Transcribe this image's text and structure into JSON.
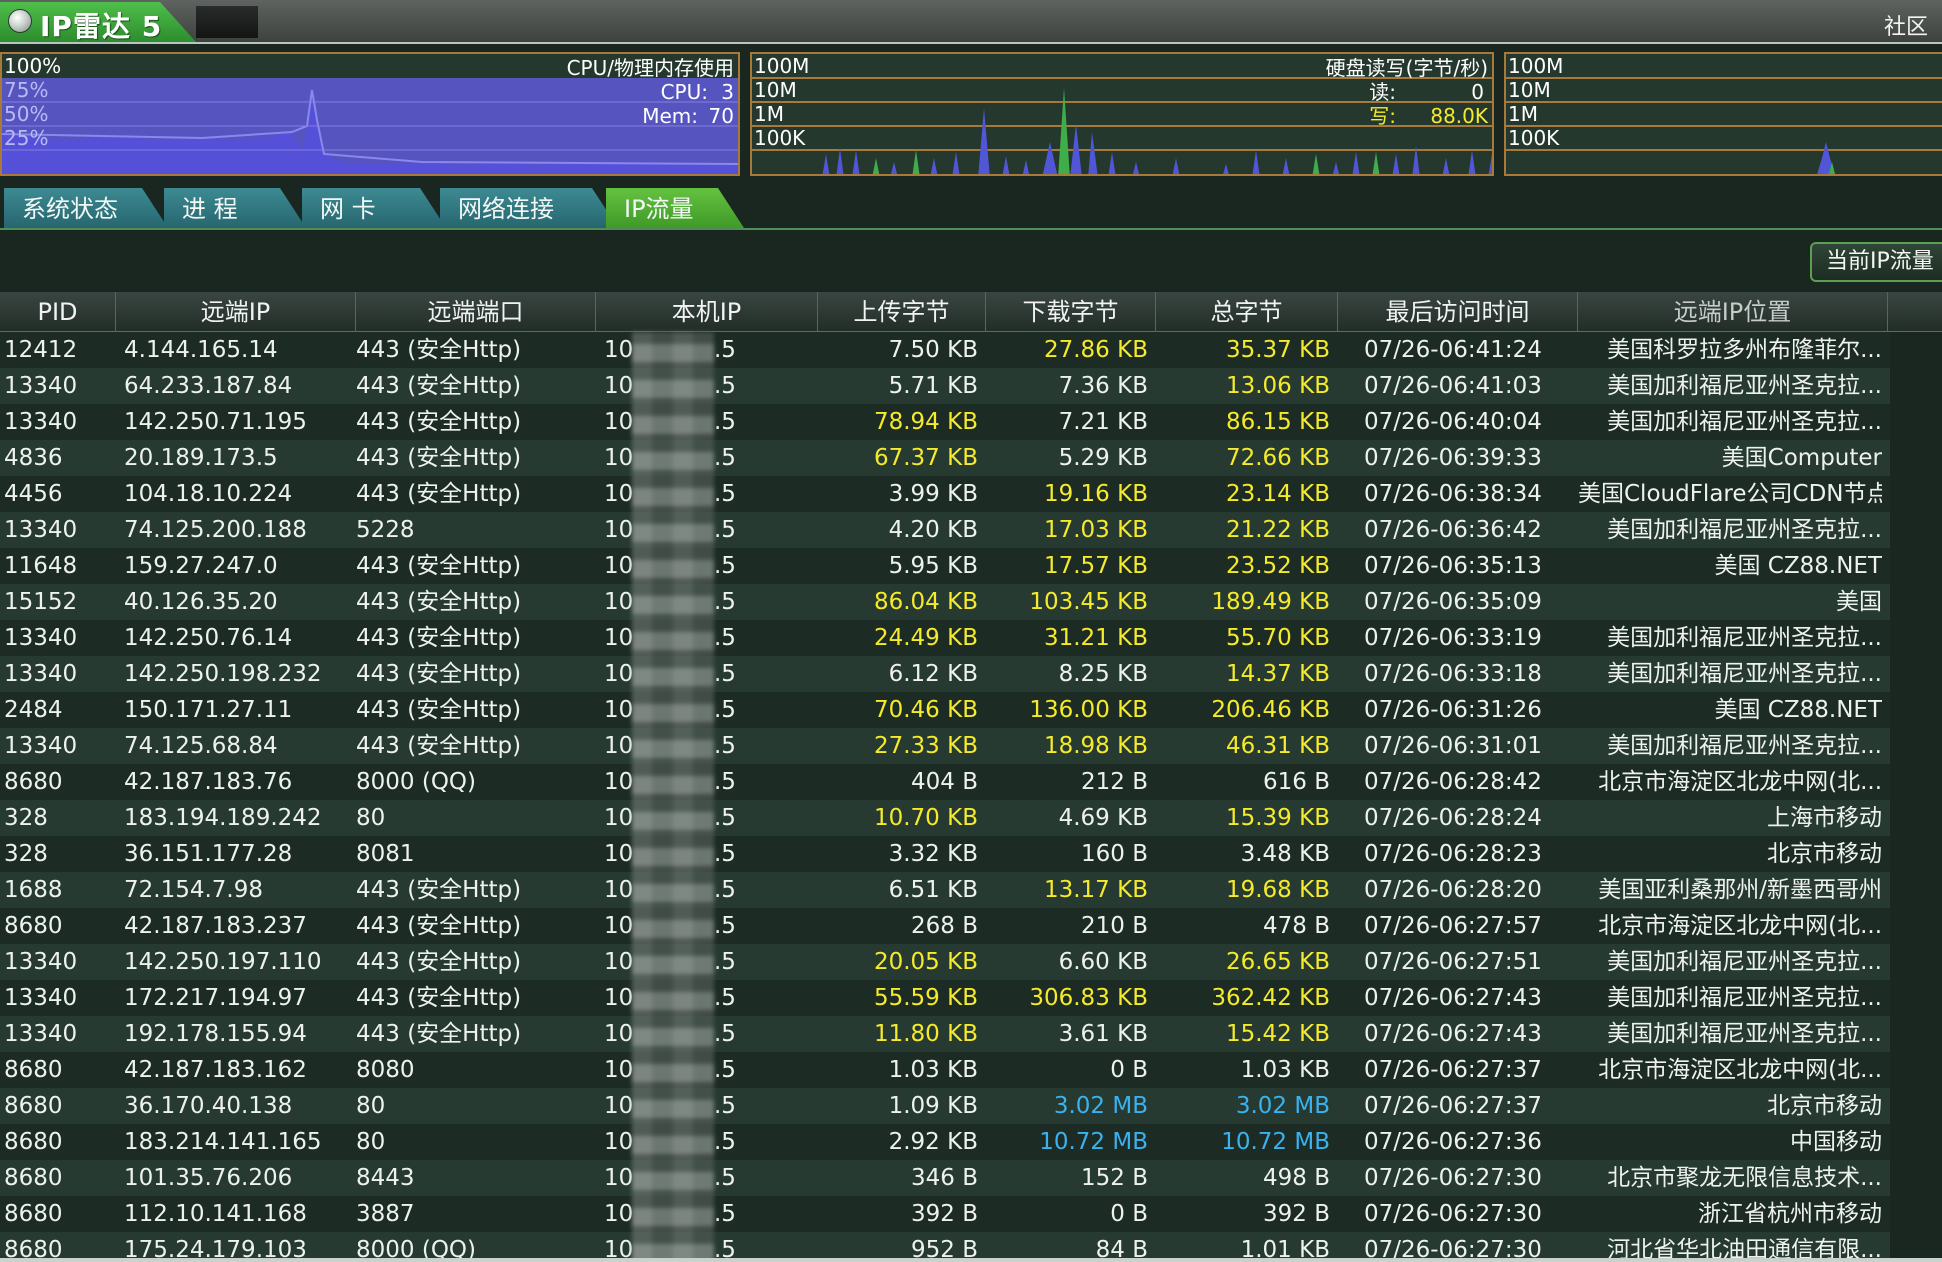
{
  "app": {
    "title": "IP雷达 5",
    "community_link": "社区"
  },
  "cpu_panel": {
    "title": "CPU/物理内存使用",
    "scale_labels": [
      "100%",
      "75%",
      "50%",
      "25%"
    ],
    "cpu_label": "CPU:",
    "cpu_value": "3",
    "mem_label": "Mem:",
    "mem_value": "70"
  },
  "disk_panel": {
    "title": "硬盘读写(字节/秒)",
    "scale_labels": [
      "100M",
      "10M",
      "1M",
      "100K"
    ],
    "read_label": "读:",
    "read_value": "0",
    "write_label": "写:",
    "write_value": "88.0K"
  },
  "net_panel": {
    "scale_labels": [
      "100M",
      "10M",
      "1M",
      "100K"
    ]
  },
  "tabs": [
    {
      "label": "系统状态"
    },
    {
      "label": "进 程"
    },
    {
      "label": "网 卡"
    },
    {
      "label": "网络连接"
    },
    {
      "label": "IP流量"
    }
  ],
  "active_tab": "IP流量",
  "toolbar": {
    "current_ip_button": "当前IP流量"
  },
  "colors": {
    "highlight_yellow": "#f5ea2c",
    "highlight_blue": "#3ab2ef",
    "active_tab": "#4fae32"
  },
  "table": {
    "columns": [
      "PID",
      "远端IP",
      "远端端口",
      "本机IP",
      "上传字节",
      "下载字节",
      "总字节",
      "最后访问时间",
      "远端IP位置"
    ],
    "rows": [
      {
        "pid": "12412",
        "remote_ip": "4.144.165.14",
        "port": "443 (安全Http)",
        "local_ip_start": "10",
        "local_ip_end": ".5",
        "upload": "7.50 KB",
        "download": "27.86 KB",
        "total": "35.37 KB",
        "time": "07/26-06:41:24",
        "location": "美国科罗拉多州布隆菲尔...",
        "hl_upload": "",
        "hl_download": "yellow",
        "hl_total": "yellow"
      },
      {
        "pid": "13340",
        "remote_ip": "64.233.187.84",
        "port": "443 (安全Http)",
        "local_ip_start": "10",
        "local_ip_end": ".5",
        "upload": "5.71 KB",
        "download": "7.36 KB",
        "total": "13.06 KB",
        "time": "07/26-06:41:03",
        "location": "美国加利福尼亚州圣克拉...",
        "hl_upload": "",
        "hl_download": "",
        "hl_total": "yellow"
      },
      {
        "pid": "13340",
        "remote_ip": "142.250.71.195",
        "port": "443 (安全Http)",
        "local_ip_start": "10",
        "local_ip_end": ".5",
        "upload": "78.94 KB",
        "download": "7.21 KB",
        "total": "86.15 KB",
        "time": "07/26-06:40:04",
        "location": "美国加利福尼亚州圣克拉...",
        "hl_upload": "yellow",
        "hl_download": "",
        "hl_total": "yellow"
      },
      {
        "pid": "4836",
        "remote_ip": "20.189.173.5",
        "port": "443 (安全Http)",
        "local_ip_start": "10",
        "local_ip_end": ".5",
        "upload": "67.37 KB",
        "download": "5.29 KB",
        "total": "72.66 KB",
        "time": "07/26-06:39:33",
        "location": "美国Computer",
        "hl_upload": "yellow",
        "hl_download": "",
        "hl_total": "yellow"
      },
      {
        "pid": "4456",
        "remote_ip": "104.18.10.224",
        "port": "443 (安全Http)",
        "local_ip_start": "10",
        "local_ip_end": ".5",
        "upload": "3.99 KB",
        "download": "19.16 KB",
        "total": "23.14 KB",
        "time": "07/26-06:38:34",
        "location": "美国CloudFlare公司CDN节点",
        "hl_upload": "",
        "hl_download": "yellow",
        "hl_total": "yellow"
      },
      {
        "pid": "13340",
        "remote_ip": "74.125.200.188",
        "port": "5228",
        "local_ip_start": "10",
        "local_ip_end": ".5",
        "upload": "4.20 KB",
        "download": "17.03 KB",
        "total": "21.22 KB",
        "time": "07/26-06:36:42",
        "location": "美国加利福尼亚州圣克拉...",
        "hl_upload": "",
        "hl_download": "yellow",
        "hl_total": "yellow"
      },
      {
        "pid": "11648",
        "remote_ip": "159.27.247.0",
        "port": "443 (安全Http)",
        "local_ip_start": "10",
        "local_ip_end": ".5",
        "upload": "5.95 KB",
        "download": "17.57 KB",
        "total": "23.52 KB",
        "time": "07/26-06:35:13",
        "location": "美国 CZ88.NET",
        "hl_upload": "",
        "hl_download": "yellow",
        "hl_total": "yellow"
      },
      {
        "pid": "15152",
        "remote_ip": "40.126.35.20",
        "port": "443 (安全Http)",
        "local_ip_start": "10",
        "local_ip_end": ".5",
        "upload": "86.04 KB",
        "download": "103.45 KB",
        "total": "189.49 KB",
        "time": "07/26-06:35:09",
        "location": "美国",
        "hl_upload": "yellow",
        "hl_download": "yellow",
        "hl_total": "yellow"
      },
      {
        "pid": "13340",
        "remote_ip": "142.250.76.14",
        "port": "443 (安全Http)",
        "local_ip_start": "10",
        "local_ip_end": ".5",
        "upload": "24.49 KB",
        "download": "31.21 KB",
        "total": "55.70 KB",
        "time": "07/26-06:33:19",
        "location": "美国加利福尼亚州圣克拉...",
        "hl_upload": "yellow",
        "hl_download": "yellow",
        "hl_total": "yellow"
      },
      {
        "pid": "13340",
        "remote_ip": "142.250.198.232",
        "port": "443 (安全Http)",
        "local_ip_start": "10",
        "local_ip_end": ".5",
        "upload": "6.12 KB",
        "download": "8.25 KB",
        "total": "14.37 KB",
        "time": "07/26-06:33:18",
        "location": "美国加利福尼亚州圣克拉...",
        "hl_upload": "",
        "hl_download": "",
        "hl_total": "yellow"
      },
      {
        "pid": "2484",
        "remote_ip": "150.171.27.11",
        "port": "443 (安全Http)",
        "local_ip_start": "10",
        "local_ip_end": ".5",
        "upload": "70.46 KB",
        "download": "136.00 KB",
        "total": "206.46 KB",
        "time": "07/26-06:31:26",
        "location": "美国 CZ88.NET",
        "hl_upload": "yellow",
        "hl_download": "yellow",
        "hl_total": "yellow"
      },
      {
        "pid": "13340",
        "remote_ip": "74.125.68.84",
        "port": "443 (安全Http)",
        "local_ip_start": "10",
        "local_ip_end": ".5",
        "upload": "27.33 KB",
        "download": "18.98 KB",
        "total": "46.31 KB",
        "time": "07/26-06:31:01",
        "location": "美国加利福尼亚州圣克拉...",
        "hl_upload": "yellow",
        "hl_download": "yellow",
        "hl_total": "yellow"
      },
      {
        "pid": "8680",
        "remote_ip": "42.187.183.76",
        "port": "8000 (QQ)",
        "local_ip_start": "10",
        "local_ip_end": ".5",
        "upload": "404 B",
        "download": "212 B",
        "total": "616 B",
        "time": "07/26-06:28:42",
        "location": "北京市海淀区北龙中网(北...",
        "hl_upload": "",
        "hl_download": "",
        "hl_total": ""
      },
      {
        "pid": "328",
        "remote_ip": "183.194.189.242",
        "port": "80",
        "local_ip_start": "10",
        "local_ip_end": ".5",
        "upload": "10.70 KB",
        "download": "4.69 KB",
        "total": "15.39 KB",
        "time": "07/26-06:28:24",
        "location": "上海市移动",
        "hl_upload": "yellow",
        "hl_download": "",
        "hl_total": "yellow"
      },
      {
        "pid": "328",
        "remote_ip": "36.151.177.28",
        "port": "8081",
        "local_ip_start": "10",
        "local_ip_end": ".5",
        "upload": "3.32 KB",
        "download": "160 B",
        "total": "3.48 KB",
        "time": "07/26-06:28:23",
        "location": "北京市移动",
        "hl_upload": "",
        "hl_download": "",
        "hl_total": ""
      },
      {
        "pid": "1688",
        "remote_ip": "72.154.7.98",
        "port": "443 (安全Http)",
        "local_ip_start": "10",
        "local_ip_end": ".5",
        "upload": "6.51 KB",
        "download": "13.17 KB",
        "total": "19.68 KB",
        "time": "07/26-06:28:20",
        "location": "美国亚利桑那州/新墨西哥州",
        "hl_upload": "",
        "hl_download": "yellow",
        "hl_total": "yellow"
      },
      {
        "pid": "8680",
        "remote_ip": "42.187.183.237",
        "port": "443 (安全Http)",
        "local_ip_start": "10",
        "local_ip_end": ".5",
        "upload": "268 B",
        "download": "210 B",
        "total": "478 B",
        "time": "07/26-06:27:57",
        "location": "北京市海淀区北龙中网(北...",
        "hl_upload": "",
        "hl_download": "",
        "hl_total": ""
      },
      {
        "pid": "13340",
        "remote_ip": "142.250.197.110",
        "port": "443 (安全Http)",
        "local_ip_start": "10",
        "local_ip_end": ".5",
        "upload": "20.05 KB",
        "download": "6.60 KB",
        "total": "26.65 KB",
        "time": "07/26-06:27:51",
        "location": "美国加利福尼亚州圣克拉...",
        "hl_upload": "yellow",
        "hl_download": "",
        "hl_total": "yellow"
      },
      {
        "pid": "13340",
        "remote_ip": "172.217.194.97",
        "port": "443 (安全Http)",
        "local_ip_start": "10",
        "local_ip_end": ".5",
        "upload": "55.59 KB",
        "download": "306.83 KB",
        "total": "362.42 KB",
        "time": "07/26-06:27:43",
        "location": "美国加利福尼亚州圣克拉...",
        "hl_upload": "yellow",
        "hl_download": "yellow",
        "hl_total": "yellow"
      },
      {
        "pid": "13340",
        "remote_ip": "192.178.155.94",
        "port": "443 (安全Http)",
        "local_ip_start": "10",
        "local_ip_end": ".5",
        "upload": "11.80 KB",
        "download": "3.61 KB",
        "total": "15.42 KB",
        "time": "07/26-06:27:43",
        "location": "美国加利福尼亚州圣克拉...",
        "hl_upload": "yellow",
        "hl_download": "",
        "hl_total": "yellow"
      },
      {
        "pid": "8680",
        "remote_ip": "42.187.183.162",
        "port": "8080",
        "local_ip_start": "10",
        "local_ip_end": ".5",
        "upload": "1.03 KB",
        "download": "0 B",
        "total": "1.03 KB",
        "time": "07/26-06:27:37",
        "location": "北京市海淀区北龙中网(北...",
        "hl_upload": "",
        "hl_download": "",
        "hl_total": ""
      },
      {
        "pid": "8680",
        "remote_ip": "36.170.40.138",
        "port": "80",
        "local_ip_start": "10",
        "local_ip_end": ".5",
        "upload": "1.09 KB",
        "download": "3.02 MB",
        "total": "3.02 MB",
        "time": "07/26-06:27:37",
        "location": "北京市移动",
        "hl_upload": "",
        "hl_download": "blue",
        "hl_total": "blue"
      },
      {
        "pid": "8680",
        "remote_ip": "183.214.141.165",
        "port": "80",
        "local_ip_start": "10",
        "local_ip_end": ".5",
        "upload": "2.92 KB",
        "download": "10.72 MB",
        "total": "10.72 MB",
        "time": "07/26-06:27:36",
        "location": "中国移动",
        "hl_upload": "",
        "hl_download": "blue",
        "hl_total": "blue"
      },
      {
        "pid": "8680",
        "remote_ip": "101.35.76.206",
        "port": "8443",
        "local_ip_start": "10",
        "local_ip_end": ".5",
        "upload": "346 B",
        "download": "152 B",
        "total": "498 B",
        "time": "07/26-06:27:30",
        "location": "北京市聚龙无限信息技术...",
        "hl_upload": "",
        "hl_download": "",
        "hl_total": ""
      },
      {
        "pid": "8680",
        "remote_ip": "112.10.141.168",
        "port": "3887",
        "local_ip_start": "10",
        "local_ip_end": ".5",
        "upload": "392 B",
        "download": "0 B",
        "total": "392 B",
        "time": "07/26-06:27:30",
        "location": "浙江省杭州市移动",
        "hl_upload": "",
        "hl_download": "",
        "hl_total": ""
      },
      {
        "pid": "8680",
        "remote_ip": "175.24.179.103",
        "port": "8000 (QQ)",
        "local_ip_start": "10",
        "local_ip_end": ".5",
        "upload": "952 B",
        "download": "84 B",
        "total": "1.01 KB",
        "time": "07/26-06:27:30",
        "location": "河北省华北油田通信有限...",
        "hl_upload": "",
        "hl_download": "",
        "hl_total": ""
      }
    ]
  }
}
